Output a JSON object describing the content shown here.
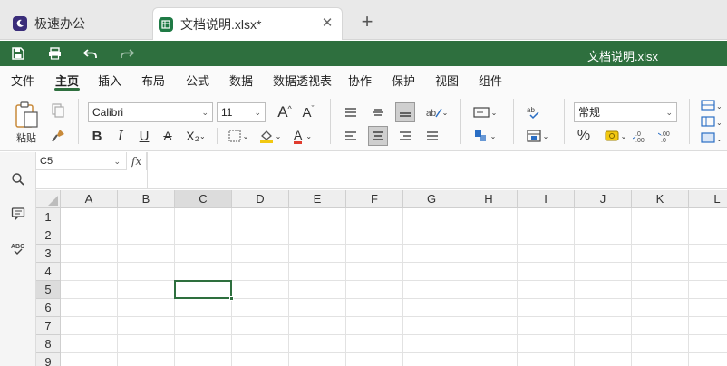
{
  "tabs": [
    {
      "title": "极速办公",
      "icon": "moon-logo-icon"
    },
    {
      "title": "文档说明.xlsx*",
      "icon": "spreadsheet-icon",
      "close": "✕"
    }
  ],
  "add_tab": "+",
  "document_title": "文档说明.xlsx",
  "menu": [
    "文件",
    "主页",
    "插入",
    "布局",
    "公式",
    "数据",
    "数据透视表",
    "协作",
    "保护",
    "视图",
    "组件"
  ],
  "active_menu": "主页",
  "ribbon": {
    "paste_label": "粘贴",
    "font_name": "Calibri",
    "font_size": "11",
    "number_format": "常规",
    "bold": "B",
    "italic": "I",
    "underline": "U",
    "strike": "A",
    "subscript": "X₂",
    "percent": "%",
    "increase_font": "A",
    "decrease_font": "A",
    "font_color_letter": "A",
    "font_color": "#e03b2e",
    "fill_color": "#f2c811"
  },
  "name_box": "C5",
  "fx_label": "fx",
  "columns": [
    "A",
    "B",
    "C",
    "D",
    "E",
    "F",
    "G",
    "H",
    "I",
    "J",
    "K",
    "L"
  ],
  "rows": [
    "1",
    "2",
    "3",
    "4",
    "5",
    "6",
    "7",
    "8",
    "9"
  ],
  "selected_cell": {
    "column": "C",
    "row": "5"
  },
  "colors": {
    "accent": "#2e6f3e",
    "tab_sheet": "#1f7a45",
    "tab_home": "#3a2d7a"
  }
}
